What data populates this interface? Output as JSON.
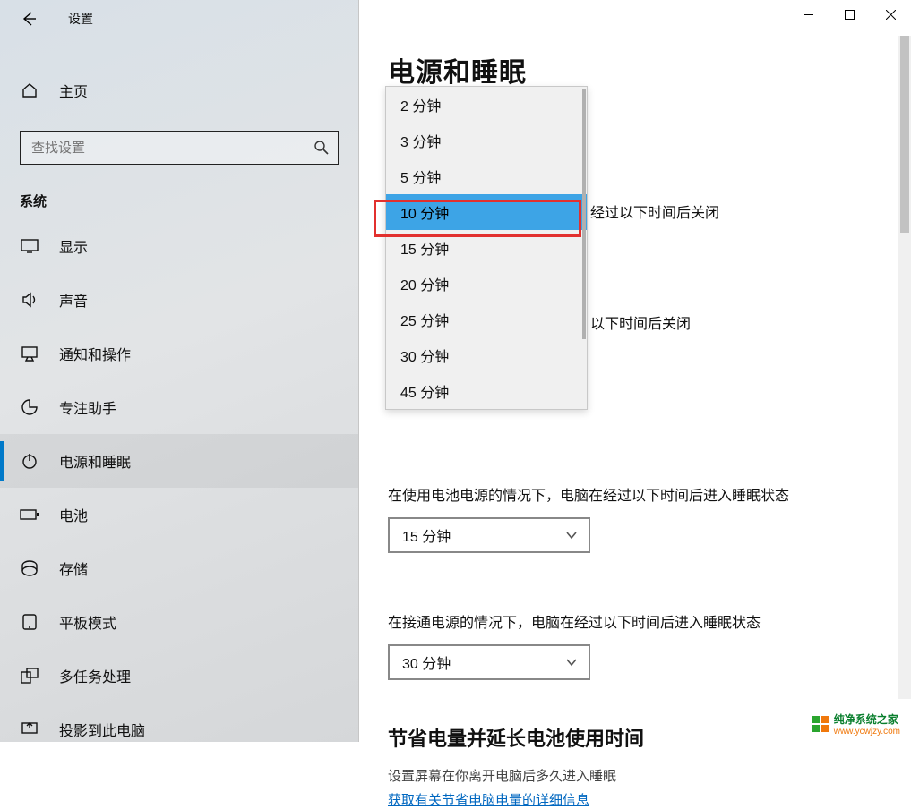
{
  "window": {
    "title": "设置"
  },
  "sidebar": {
    "home": "主页",
    "search_placeholder": "查找设置",
    "category": "系统",
    "items": [
      {
        "label": "显示"
      },
      {
        "label": "声音"
      },
      {
        "label": "通知和操作"
      },
      {
        "label": "专注助手"
      },
      {
        "label": "电源和睡眠"
      },
      {
        "label": "电池"
      },
      {
        "label": "存储"
      },
      {
        "label": "平板模式"
      },
      {
        "label": "多任务处理"
      },
      {
        "label": "投影到此电脑"
      }
    ],
    "active_index": 4
  },
  "main": {
    "heading": "电源和睡眠",
    "screen_off_battery_visible": "经过以下时间后关闭",
    "screen_off_plugged_visible": "以下时间后关闭",
    "sleep_battery_label": "在使用电池电源的情况下，电脑在经过以下时间后进入睡眠状态",
    "sleep_battery_value": "15 分钟",
    "sleep_plugged_label": "在接通电源的情况下，电脑在经过以下时间后进入睡眠状态",
    "sleep_plugged_value": "30 分钟",
    "save_heading": "节省电量并延长电池使用时间",
    "save_sub": "设置屏幕在你离开电脑后多久进入睡眠",
    "save_link": "获取有关节省电脑电量的详细信息"
  },
  "dropdown": {
    "options": [
      "2 分钟",
      "3 分钟",
      "5 分钟",
      "10 分钟",
      "15 分钟",
      "20 分钟",
      "25 分钟",
      "30 分钟",
      "45 分钟"
    ],
    "selected_index": 3
  },
  "watermark": {
    "name": "纯净系统之家",
    "url": "www.ycwjzy.com"
  }
}
